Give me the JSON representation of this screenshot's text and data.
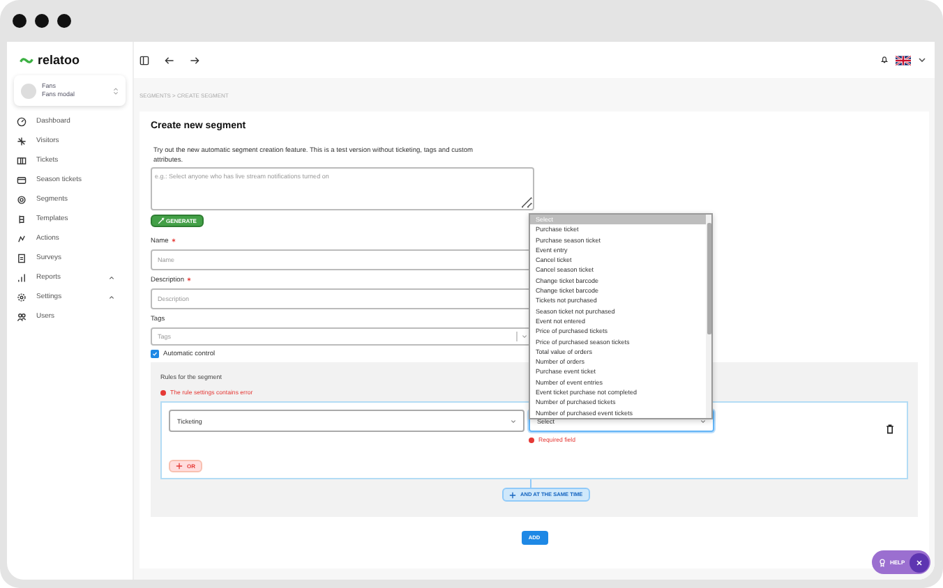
{
  "logo": {
    "text": "relatoo"
  },
  "account": {
    "name": "Fans",
    "subtitle": "Fans modal"
  },
  "sidebar": {
    "items": [
      {
        "label": "Dashboard",
        "kind": "link"
      },
      {
        "label": "Visitors",
        "kind": "link"
      },
      {
        "label": "Tickets",
        "kind": "link"
      },
      {
        "label": "Season tickets",
        "kind": "link"
      },
      {
        "label": "Segments",
        "kind": "link"
      },
      {
        "label": "Templates",
        "kind": "link"
      },
      {
        "label": "Actions",
        "kind": "link"
      },
      {
        "label": "Surveys",
        "kind": "link"
      },
      {
        "label": "Reports",
        "kind": "group",
        "expanded": false
      },
      {
        "label": "Settings",
        "kind": "group",
        "expanded": false
      },
      {
        "label": "Users",
        "kind": "link"
      }
    ]
  },
  "breadcrumb": "SEGMENTS > CREATE SEGMENT",
  "form": {
    "title": "Create new segment",
    "intro": "Try out the new automatic segment creation feature. This is a test version without ticketing, tags and custom attributes.",
    "prompt": {
      "placeholder": "e.g.: Select anyone who has live stream notifications turned on"
    },
    "generate_button": "GENERATE",
    "fields": [
      {
        "kind": "input",
        "label": "Name",
        "required": true,
        "placeholder": "Name"
      },
      {
        "kind": "input",
        "label": "Description",
        "required": true,
        "placeholder": "Description"
      },
      {
        "kind": "select",
        "label": "Tags",
        "required": false,
        "placeholder": "Tags"
      }
    ],
    "automatic_control": {
      "label": "Automatic control",
      "checked": true
    },
    "rules": {
      "title": "Rules for the segment",
      "error": "The rule settings contains error",
      "rule": {
        "category": "Ticketing",
        "condition": {
          "placeholder": "Select",
          "error": "Required field"
        }
      },
      "or_button": "OR",
      "and_button": "AND AT THE SAME TIME"
    },
    "dropdown": {
      "options": [
        {
          "label": "Select",
          "selected": true
        },
        {
          "label": "Purchase ticket",
          "selected": false
        },
        {
          "label": "Purchase season ticket",
          "selected": false
        },
        {
          "label": "Event entry",
          "selected": false
        },
        {
          "label": "Cancel ticket",
          "selected": false
        },
        {
          "label": "Cancel season ticket",
          "selected": false
        },
        {
          "label": "Change ticket barcode",
          "selected": false
        },
        {
          "label": "Change ticket barcode",
          "selected": false
        },
        {
          "label": "Tickets not purchased",
          "selected": false
        },
        {
          "label": "Season ticket not purchased",
          "selected": false
        },
        {
          "label": "Event not entered",
          "selected": false
        },
        {
          "label": "Price of purchased tickets",
          "selected": false
        },
        {
          "label": "Price of purchased season tickets",
          "selected": false
        },
        {
          "label": "Total value of orders",
          "selected": false
        },
        {
          "label": "Number of orders",
          "selected": false
        },
        {
          "label": "Purchase event ticket",
          "selected": false
        },
        {
          "label": "Number of event entries",
          "selected": false
        },
        {
          "label": "Event ticket purchase not completed",
          "selected": false
        },
        {
          "label": "Number of purchased tickets",
          "selected": false
        },
        {
          "label": "Number of purchased event tickets",
          "selected": false
        }
      ]
    },
    "add_button": "ADD"
  },
  "help_button": "HELP"
}
